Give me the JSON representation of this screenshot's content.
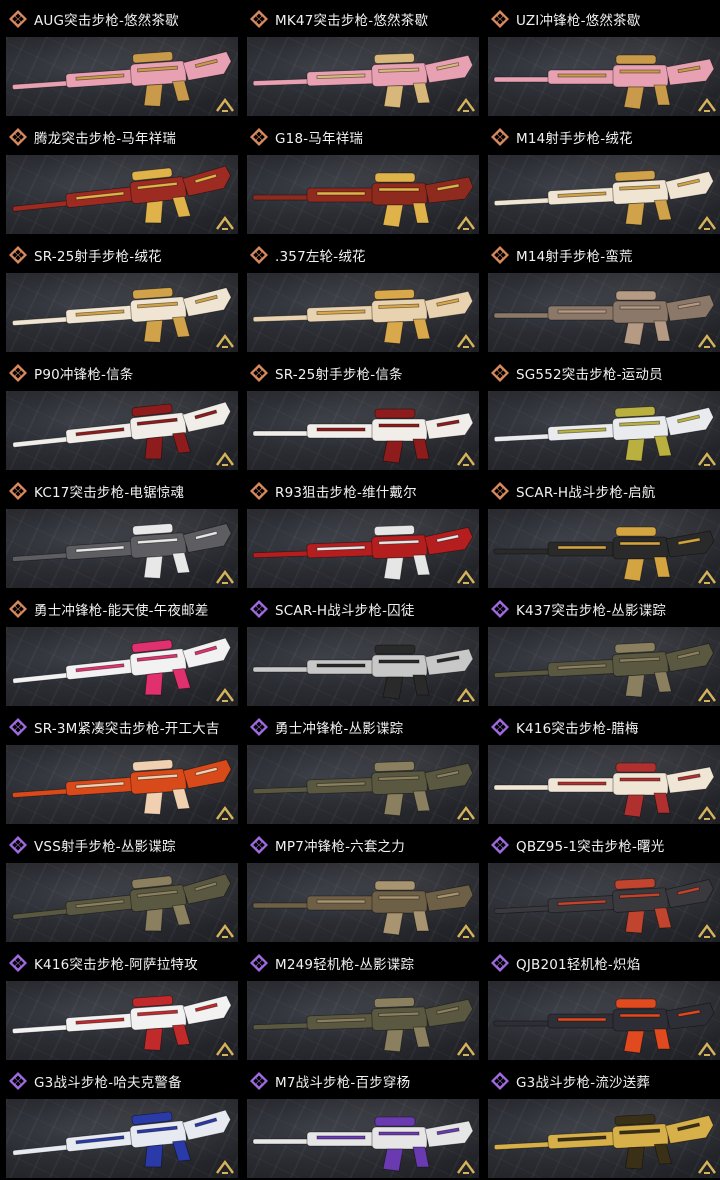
{
  "colors": {
    "legendary": "#d98a5c",
    "epic": "#a06be0",
    "background": "#000000",
    "text": "#f2f2f2",
    "corner": "#d6b35a"
  },
  "cards": [
    {
      "title": "AUG突击步枪-悠然茶歇",
      "rarity": "legendary",
      "skin": "#e7a1b2",
      "accent": "#c99a4a"
    },
    {
      "title": "MK47突击步枪-悠然茶歇",
      "rarity": "legendary",
      "skin": "#e7a1b2",
      "accent": "#d8b77b"
    },
    {
      "title": "UZI冲锋枪-悠然茶歇",
      "rarity": "legendary",
      "skin": "#e7a1b2",
      "accent": "#c99a4a"
    },
    {
      "title": "腾龙突击步枪-马年祥瑞",
      "rarity": "legendary",
      "skin": "#9e2b22",
      "accent": "#e0b24a"
    },
    {
      "title": "G18-马年祥瑞",
      "rarity": "legendary",
      "skin": "#8f2a1e",
      "accent": "#e0b24a"
    },
    {
      "title": "M14射手步枪-绒花",
      "rarity": "legendary",
      "skin": "#f0e4d2",
      "accent": "#d0a24a"
    },
    {
      "title": "SR-25射手步枪-绒花",
      "rarity": "legendary",
      "skin": "#f0e4d2",
      "accent": "#d0a24a"
    },
    {
      "title": ".357左轮-绒花",
      "rarity": "legendary",
      "skin": "#e8d2b0",
      "accent": "#d9a84a"
    },
    {
      "title": "M14射手步枪-蛮荒",
      "rarity": "legendary",
      "skin": "#8b7868",
      "accent": "#b59a84"
    },
    {
      "title": "P90冲锋枪-信条",
      "rarity": "legendary",
      "skin": "#f1eeea",
      "accent": "#8e1c1c"
    },
    {
      "title": "SR-25射手步枪-信条",
      "rarity": "legendary",
      "skin": "#f1eeea",
      "accent": "#8e1c1c"
    },
    {
      "title": "SG552突击步枪-运动员",
      "rarity": "legendary",
      "skin": "#e9ebee",
      "accent": "#b9b040"
    },
    {
      "title": "KC17突击步枪-电锯惊魂",
      "rarity": "legendary",
      "skin": "#5e5e62",
      "accent": "#e8e8e8"
    },
    {
      "title": "R93狙击步枪-维什戴尔",
      "rarity": "legendary",
      "skin": "#b51e1e",
      "accent": "#e6e6e6"
    },
    {
      "title": "SCAR-H战斗步枪-启航",
      "rarity": "legendary",
      "skin": "#2a2a2a",
      "accent": "#d4a440"
    },
    {
      "title": "勇士冲锋枪-能天使-午夜邮差",
      "rarity": "legendary",
      "skin": "#f2f2f2",
      "accent": "#e0306e"
    },
    {
      "title": "SCAR-H战斗步枪-囚徒",
      "rarity": "epic",
      "skin": "#c8c8c8",
      "accent": "#2a2a2a"
    },
    {
      "title": "K437突击步枪-丛影谍踪",
      "rarity": "epic",
      "skin": "#5a5840",
      "accent": "#8a8060"
    },
    {
      "title": "SR-3M紧凑突击步枪-开工大吉",
      "rarity": "epic",
      "skin": "#d94a1a",
      "accent": "#f0d0b0"
    },
    {
      "title": "勇士冲锋枪-丛影谍踪",
      "rarity": "epic",
      "skin": "#5a5840",
      "accent": "#8a8060"
    },
    {
      "title": "K416突击步枪-腊梅",
      "rarity": "epic",
      "skin": "#f0e6d6",
      "accent": "#b03030"
    },
    {
      "title": "VSS射手步枪-丛影谍踪",
      "rarity": "epic",
      "skin": "#5a5840",
      "accent": "#8a8060"
    },
    {
      "title": "MP7冲锋枪-六套之力",
      "rarity": "epic",
      "skin": "#6e6046",
      "accent": "#a89470"
    },
    {
      "title": "QBZ95-1突击步枪-曙光",
      "rarity": "epic",
      "skin": "#3a3a3e",
      "accent": "#c0442e"
    },
    {
      "title": "K416突击步枪-阿萨拉特攻",
      "rarity": "epic",
      "skin": "#f2f2f2",
      "accent": "#c02a2a"
    },
    {
      "title": "M249轻机枪-丛影谍踪",
      "rarity": "epic",
      "skin": "#5a5840",
      "accent": "#8a8060"
    },
    {
      "title": "QJB201轻机枪-炽焰",
      "rarity": "epic",
      "skin": "#2e2e36",
      "accent": "#e04a1e"
    },
    {
      "title": "G3战斗步枪-哈夫克警备",
      "rarity": "epic",
      "skin": "#e8eaf2",
      "accent": "#2a3aa8"
    },
    {
      "title": "M7战斗步枪-百步穿杨",
      "rarity": "epic",
      "skin": "#e6e6e6",
      "accent": "#6a3ab0"
    },
    {
      "title": "G3战斗步枪-流沙送葬",
      "rarity": "epic",
      "skin": "#d8b04a",
      "accent": "#3a3018"
    }
  ]
}
